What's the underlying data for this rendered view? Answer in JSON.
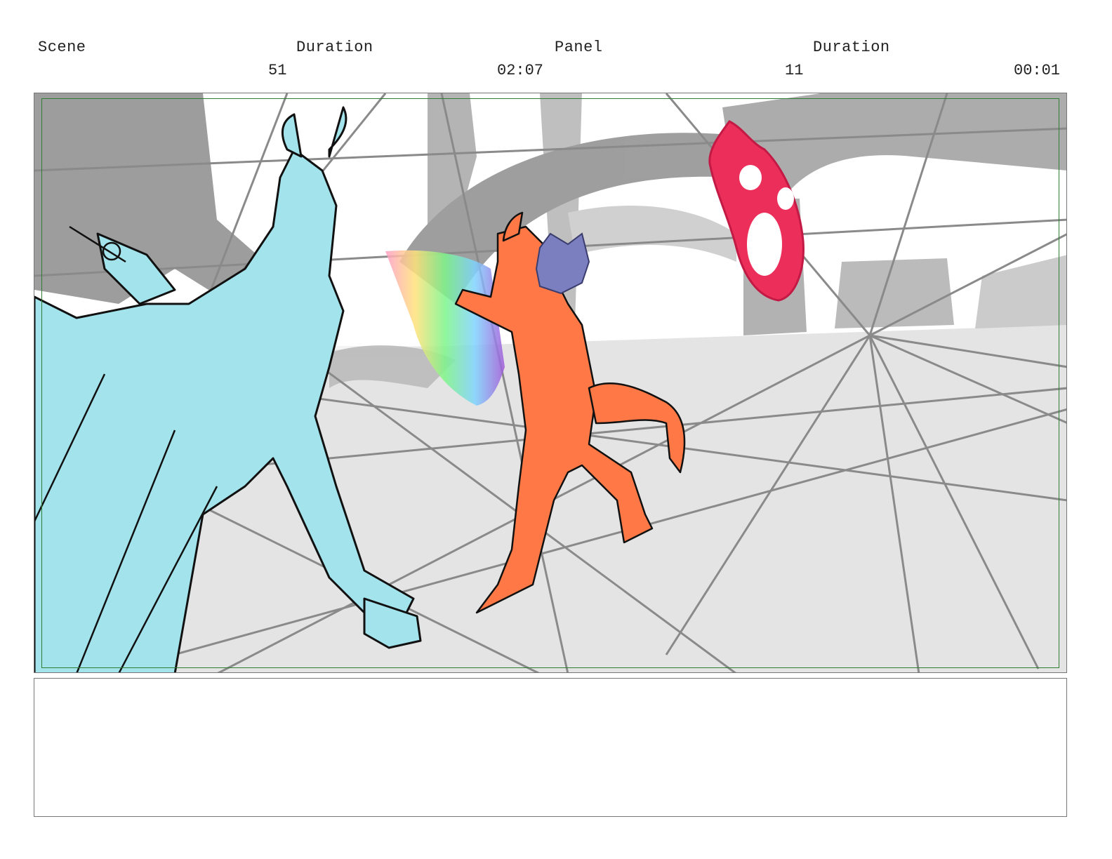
{
  "header": {
    "scene_label": "Scene",
    "scene_duration_label": "Duration",
    "panel_label": "Panel",
    "panel_duration_label": "Duration",
    "scene_number": "51",
    "scene_duration": "02:07",
    "panel_number": "11",
    "panel_duration": "00:01"
  },
  "colors": {
    "blue_character": "#a3e3ec",
    "orange_character": "#ff7845",
    "purple_creature": "#7b7fbf",
    "magic_portal": "#ec2f5a",
    "safe_area": "#2e7d32"
  },
  "notes": {
    "text": ""
  }
}
